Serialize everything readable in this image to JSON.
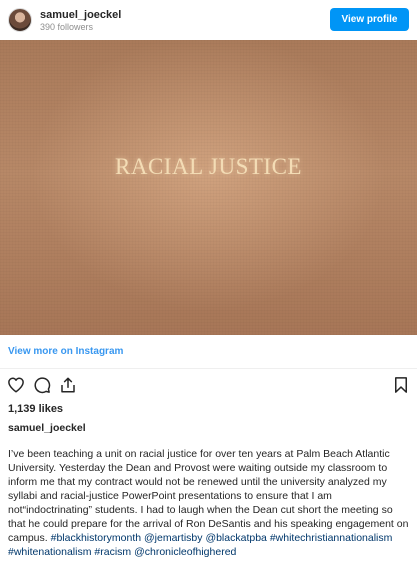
{
  "header": {
    "username": "samuel_joeckel",
    "followers": "390 followers",
    "view_profile_label": "View profile"
  },
  "media": {
    "text": "RACIAL JUSTICE"
  },
  "view_more_label": "View more on Instagram",
  "actions": {
    "icons": [
      "heart-icon",
      "comment-icon",
      "share-icon",
      "bookmark-icon"
    ]
  },
  "likes": "1,139 likes",
  "caption": {
    "username": "samuel_joeckel",
    "text": "I’ve been teaching a unit on racial justice for over ten years at Palm Beach Atlantic University. Yesterday the Dean and Provost were waiting outside my classroom to inform me that my contract would not be renewed until the university analyzed my syllabi and racial-justice PowerPoint presentations to ensure that I am not“indoctrinating” students. I had to laugh when the Dean cut short the meeting so that he could prepare for the arrival of Ron DeSantis and his speaking engagement on campus.",
    "tags": [
      "#blackhistorymonth",
      "@jemartisby",
      "@blackatpba",
      "#whitechristiannationalism",
      "#whitenationalism",
      "#racism",
      "@chronicleofhighered"
    ]
  },
  "colors": {
    "accent": "#0095f6",
    "link": "#3897f0",
    "tag": "#00376b"
  }
}
